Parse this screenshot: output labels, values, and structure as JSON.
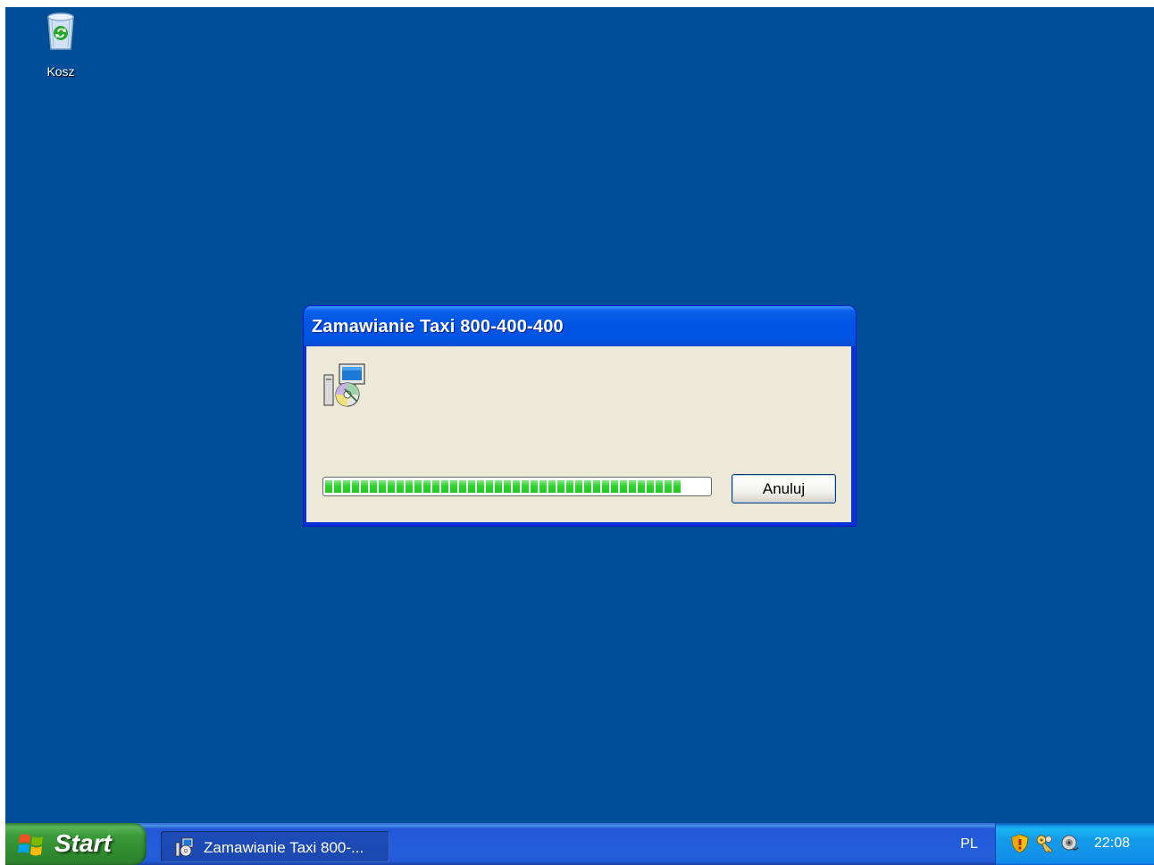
{
  "desktop": {
    "background_color": "#004E98",
    "icons": [
      {
        "label": "Kosz",
        "icon": "recycle-bin-icon"
      }
    ]
  },
  "dialog": {
    "title": "Zamawianie Taxi 800-400-400",
    "icon": "setup-installer-icon",
    "progress_fraction": 0.93,
    "cancel_label": "Anuluj"
  },
  "taskbar": {
    "start_label": "Start",
    "task": {
      "label": "Zamawianie Taxi 800-...",
      "icon": "setup-installer-icon"
    },
    "language": "PL",
    "tray_icons": [
      "security-shield-icon",
      "network-keys-icon",
      "volume-icon"
    ],
    "clock": "22:08"
  },
  "colors": {
    "title_bar": "#0055E5",
    "dialog_body": "#ECE9D8",
    "progress_fill": "#2FD42F",
    "start_button": "#3B9B3B",
    "taskbar": "#245EDC",
    "tray": "#1290E8"
  }
}
